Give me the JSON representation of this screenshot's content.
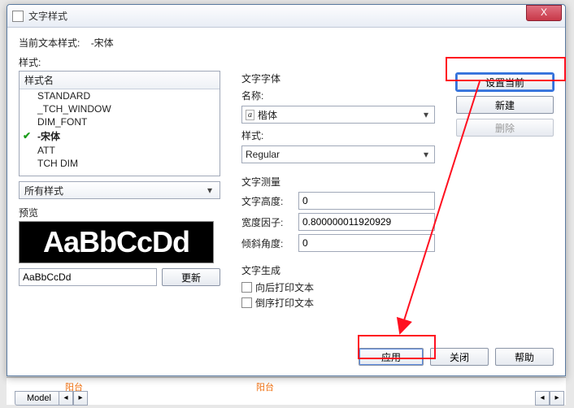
{
  "window": {
    "title": "文字样式",
    "close": "X"
  },
  "current": {
    "label": "当前文本样式:",
    "value": "-宋体"
  },
  "styles": {
    "label": "样式:",
    "header": "样式名",
    "items": [
      "STANDARD",
      "_TCH_WINDOW",
      "DIM_FONT",
      "-宋体",
      "ATT",
      "TCH DIM"
    ],
    "selected_index": 3
  },
  "filter": {
    "value": "所有样式"
  },
  "preview": {
    "label": "预览",
    "big": "AaBbCcDd",
    "input": "AaBbCcDd",
    "update": "更新"
  },
  "font": {
    "section": "文字字体",
    "name_label": "名称:",
    "name_value": "楷体",
    "style_label": "样式:",
    "style_value": "Regular"
  },
  "measure": {
    "section": "文字测量",
    "height_label": "文字高度:",
    "height_value": "0",
    "width_label": "宽度因子:",
    "width_value": "0.800000011920929",
    "oblique_label": "倾斜角度:",
    "oblique_value": "0"
  },
  "gen": {
    "section": "文字生成",
    "backward": "向后打印文本",
    "reverse": "倒序打印文本"
  },
  "buttons": {
    "set_current": "设置当前",
    "new": "新建",
    "delete": "删除",
    "apply": "应用",
    "close": "关闭",
    "help": "帮助"
  },
  "bg": {
    "label1": "阳台",
    "label2": "阳台",
    "model": "Model"
  }
}
